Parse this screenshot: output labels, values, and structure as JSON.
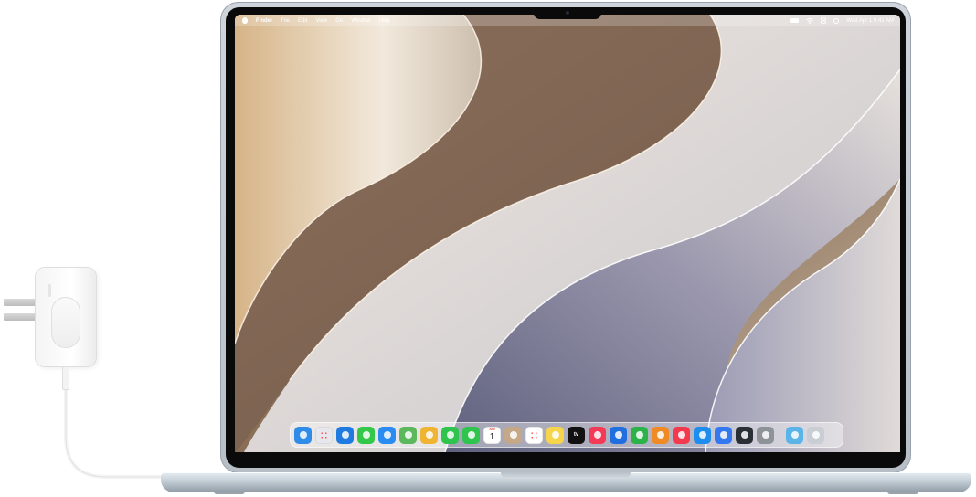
{
  "menubar": {
    "app": "Finder",
    "menus": [
      "File",
      "Edit",
      "View",
      "Go",
      "Window",
      "Help"
    ],
    "clock": "Wed Apr 1  9:41 AM",
    "status_icons": [
      "battery-icon",
      "wifi-icon",
      "control-center-icon",
      "siri-icon"
    ]
  },
  "dock": {
    "apps": [
      {
        "name": "finder",
        "icon": "finder-icon",
        "color": "#2f8ce9"
      },
      {
        "name": "launchpad",
        "icon": "launchpad-icon",
        "color": "#e6e8ee"
      },
      {
        "name": "safari",
        "icon": "safari-icon",
        "color": "#1f7be0"
      },
      {
        "name": "messages",
        "icon": "messages-icon",
        "color": "#33c849"
      },
      {
        "name": "mail",
        "icon": "mail-icon",
        "color": "#2a8cf0"
      },
      {
        "name": "maps",
        "icon": "maps-icon",
        "color": "#5bb85d"
      },
      {
        "name": "photos",
        "icon": "photos-icon",
        "color": "#f0b433"
      },
      {
        "name": "facetime",
        "icon": "facetime-icon",
        "color": "#2ec44d"
      },
      {
        "name": "phone",
        "icon": "phone-icon",
        "color": "#2ec44d"
      },
      {
        "name": "calendar",
        "icon": "calendar-icon",
        "color": "#ffffff"
      },
      {
        "name": "contacts",
        "icon": "contacts-icon",
        "color": "#c4a888"
      },
      {
        "name": "reminders",
        "icon": "reminders-icon",
        "color": "#ffffff"
      },
      {
        "name": "notes",
        "icon": "notes-icon",
        "color": "#f6d54b"
      },
      {
        "name": "tv",
        "icon": "tv-icon",
        "color": "#111111"
      },
      {
        "name": "music",
        "icon": "music-icon",
        "color": "#f33b57"
      },
      {
        "name": "keynote",
        "icon": "keynote-icon",
        "color": "#1f6fe0"
      },
      {
        "name": "numbers",
        "icon": "numbers-icon",
        "color": "#2bb34a"
      },
      {
        "name": "pages",
        "icon": "pages-icon",
        "color": "#f08a24"
      },
      {
        "name": "games",
        "icon": "games-icon",
        "color": "#f23a4c"
      },
      {
        "name": "app-store",
        "icon": "app-store-icon",
        "color": "#1d8df0"
      },
      {
        "name": "iphone-mirroring",
        "icon": "iphone-mirroring-icon",
        "color": "#3478f0"
      },
      {
        "name": "macos-installer",
        "icon": "macos-installer-icon",
        "color": "#2a2f36"
      },
      {
        "name": "system-settings",
        "icon": "system-settings-icon",
        "color": "#8e939a"
      }
    ],
    "calendar": {
      "month": "APR",
      "day": "1"
    },
    "tv_label": "tv",
    "trailing": [
      {
        "name": "downloads-folder",
        "icon": "folder-icon",
        "color": "#5ab4e8"
      },
      {
        "name": "trash",
        "icon": "trash-icon",
        "color": "#c9ced4"
      }
    ]
  },
  "device": {
    "laptop_color": "#b9c4cd",
    "adapter_color": "#f6f6f6"
  }
}
